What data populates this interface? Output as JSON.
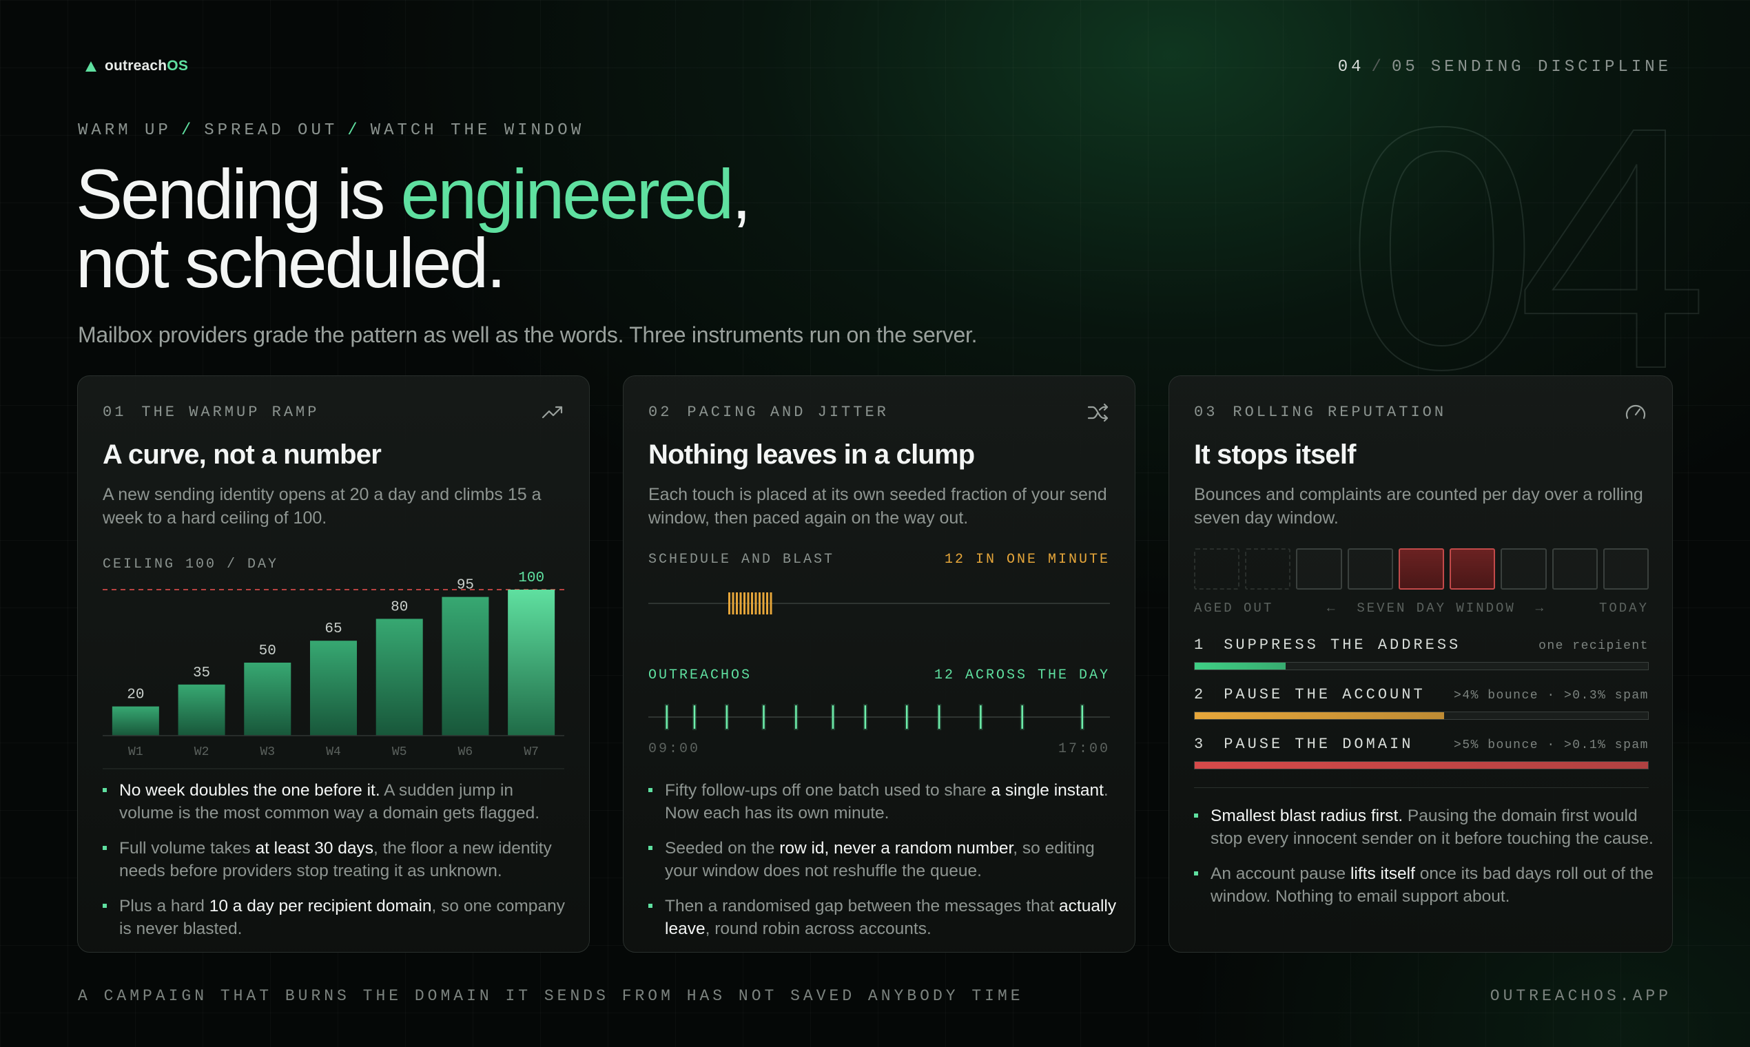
{
  "brand": {
    "name": "outreach",
    "name_suffix": "OS"
  },
  "slide": {
    "current": "04",
    "total": "05",
    "section": "SENDING DISCIPLINE",
    "big_number": "04"
  },
  "kicker": [
    "WARM UP",
    "SPREAD OUT",
    "WATCH THE WINDOW"
  ],
  "headline": {
    "part1": "Sending is ",
    "highlight": "engineered",
    "part2": ",",
    "line2": "not scheduled."
  },
  "subtitle": "Mailbox providers grade the pattern as well as the words. Three instruments run on the server.",
  "cards": [
    {
      "num": "01",
      "label": "THE WARMUP RAMP",
      "icon": "trending-up-icon",
      "title": "A curve, not a number",
      "desc": "A new sending identity opens at 20 a day and climbs 15 a week to a hard ceiling of 100.",
      "bullets": [
        {
          "strong": "No week doubles the one before it.",
          "rest": " A sudden jump in volume is the most common way a domain gets flagged."
        },
        {
          "pre": "Full volume takes ",
          "strong": "at least 30 days",
          "rest": ", the floor a new identity needs before providers stop treating it as unknown."
        },
        {
          "pre": "Plus a hard ",
          "strong": "10 a day per recipient domain",
          "rest": ", so one company is never blasted."
        }
      ]
    },
    {
      "num": "02",
      "label": "PACING AND JITTER",
      "icon": "shuffle-icon",
      "title": "Nothing leaves in a clump",
      "desc": "Each touch is placed at its own seeded fraction of your send window, then paced again on the way out.",
      "bullets": [
        {
          "pre": "Fifty follow-ups off one batch used to share ",
          "strong": "a single instant",
          "rest": ". Now each has its own minute."
        },
        {
          "pre": "Seeded on the ",
          "strong": "row id, never a random number",
          "rest": ", so editing your window does not reshuffle the queue."
        },
        {
          "pre": "Then a randomised gap between the messages that ",
          "strong": "actually leave",
          "rest": ", round robin across accounts."
        }
      ]
    },
    {
      "num": "03",
      "label": "ROLLING REPUTATION",
      "icon": "gauge-icon",
      "title": "It stops itself",
      "desc": "Bounces and complaints are counted per day over a rolling seven day window.",
      "bullets": [
        {
          "strong": "Smallest blast radius first.",
          "rest": " Pausing the domain first would stop every innocent sender on it before touching the cause."
        },
        {
          "pre": "An account pause ",
          "strong": "lifts itself",
          "rest": " once its bad days roll out of the window. Nothing to email support about."
        }
      ]
    }
  ],
  "chart_data": {
    "type": "bar",
    "categories": [
      "W1",
      "W2",
      "W3",
      "W4",
      "W5",
      "W6",
      "W7"
    ],
    "values": [
      20,
      35,
      50,
      65,
      80,
      95,
      100
    ],
    "ylim": [
      0,
      100
    ],
    "ceiling": {
      "value": 100,
      "label": "CEILING 100 / DAY"
    },
    "colors": {
      "bar": "#2f9a66",
      "bar_top": "#5fe0a0",
      "ceiling": "#d64a4a"
    }
  },
  "pacing": {
    "schedule": {
      "label": "SCHEDULE AND BLAST",
      "count_label": "12 IN ONE MINUTE",
      "ticks": 12
    },
    "outreachos": {
      "label": "OUTREACHOS",
      "count_label": "12 ACROSS THE DAY",
      "start": "09:00",
      "end": "17:00",
      "tick_fractions": [
        0.04,
        0.1,
        0.17,
        0.25,
        0.32,
        0.4,
        0.47,
        0.56,
        0.63,
        0.72,
        0.81,
        0.94
      ]
    }
  },
  "reputation": {
    "days": [
      "aged",
      "aged",
      "ok",
      "ok",
      "bad",
      "bad",
      "ok",
      "ok",
      "ok"
    ],
    "legend": {
      "left": "AGED OUT",
      "middle": "SEVEN DAY WINDOW",
      "right": "TODAY"
    },
    "rules": [
      {
        "idx": "1",
        "title": "SUPPRESS THE ADDRESS",
        "meta": "one recipient",
        "fill": 0.2,
        "color": "#3fcf85"
      },
      {
        "idx": "2",
        "title": "PAUSE THE ACCOUNT",
        "meta": ">4% bounce · >0.3% spam",
        "fill": 0.55,
        "color": "#e6a63a"
      },
      {
        "idx": "3",
        "title": "PAUSE THE DOMAIN",
        "meta": ">5% bounce · >0.1% spam",
        "fill": 1.0,
        "color": "#d64a4a"
      }
    ]
  },
  "footer": {
    "left": "A CAMPAIGN THAT BURNS THE DOMAIN IT SENDS FROM HAS NOT SAVED ANYBODY TIME",
    "right": "OUTREACHOS.APP"
  }
}
